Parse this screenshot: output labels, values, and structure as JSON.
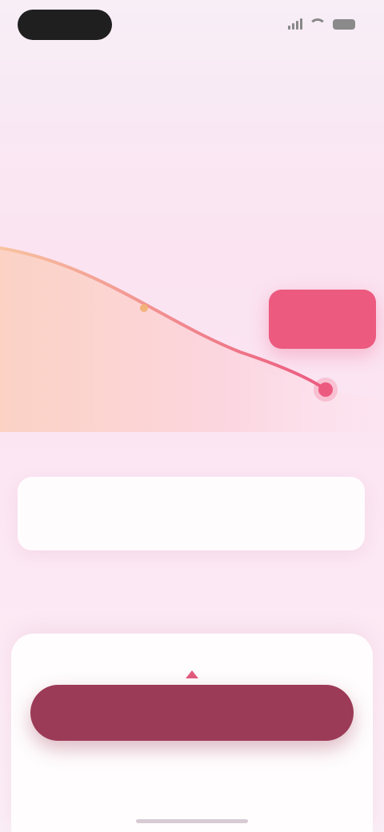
{
  "status_bar": {
    "time": "",
    "icons": [
      "signal-icon",
      "wifi-icon",
      "battery-icon"
    ]
  },
  "header": {
    "subtitle": "",
    "title_part1": "",
    "title_accent": "",
    "title_line2": ""
  },
  "chart": {
    "start_label": "",
    "mid_label": "",
    "goal_label": "",
    "goal_caption": ""
  },
  "axis": {
    "start": "",
    "mid": "",
    "end": ""
  },
  "info_card": {
    "tag": "",
    "text": ""
  },
  "disclaimer": "",
  "bottom": {
    "cta_label": "",
    "fine_print": "",
    "terms_link": ""
  },
  "colors": {
    "accent": "#f06a94",
    "cta": "#9c3b57",
    "goal": "#ec5a80"
  }
}
